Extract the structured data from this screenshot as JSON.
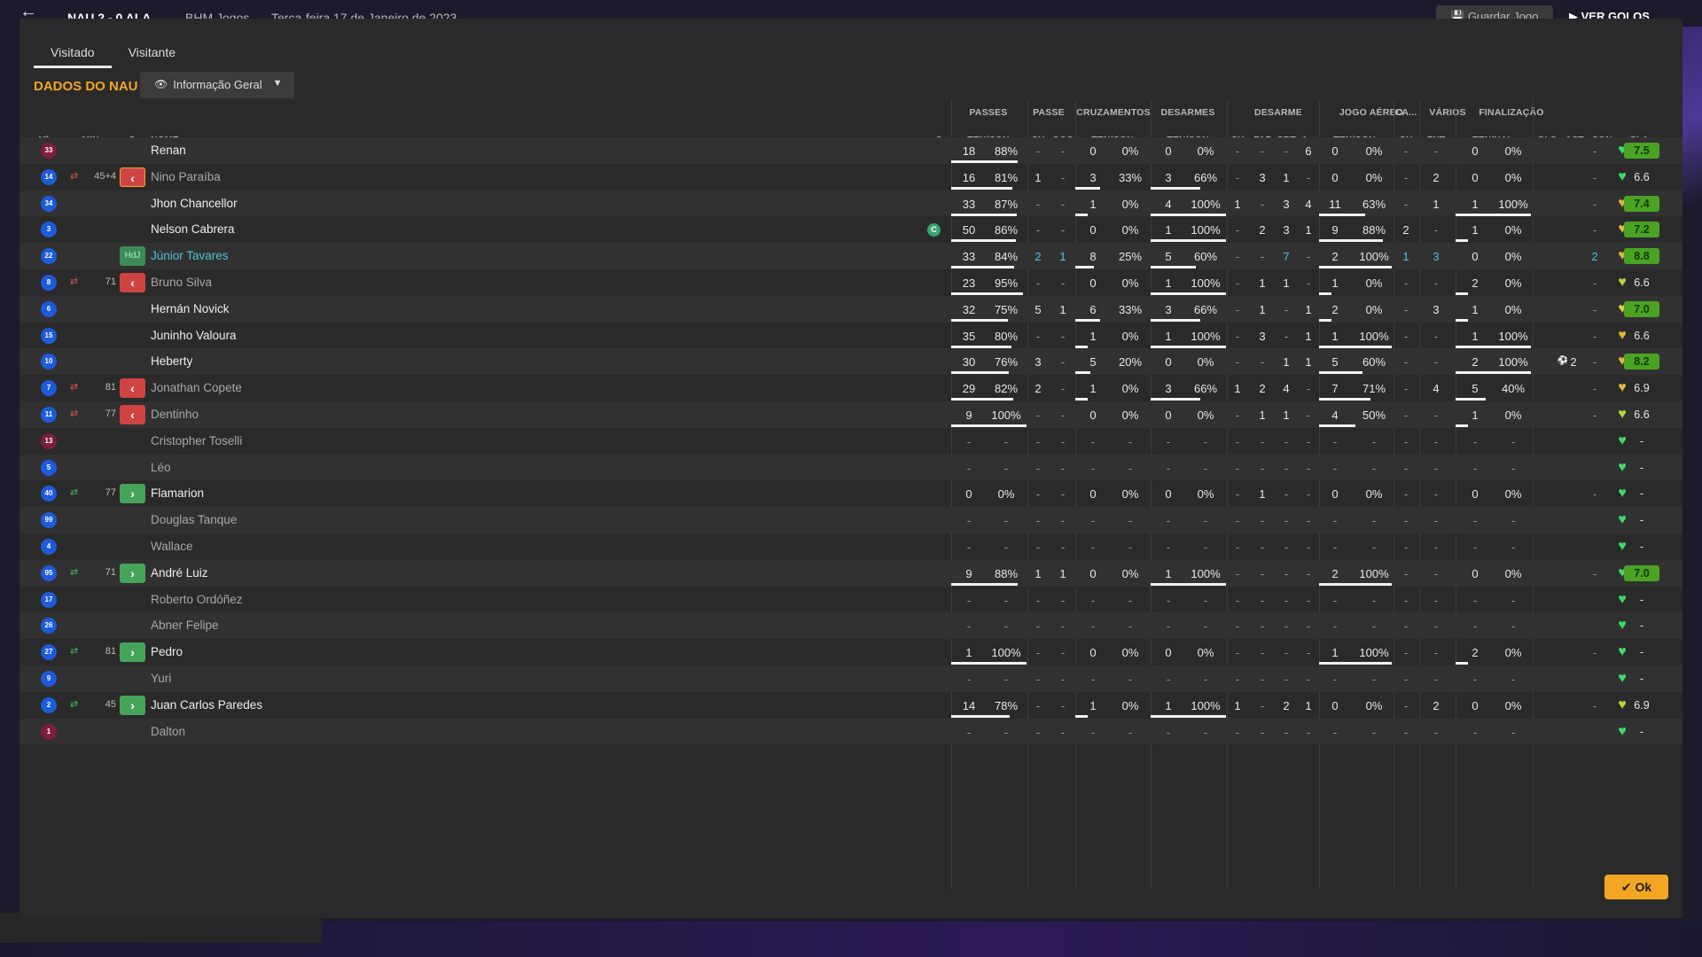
{
  "topbar": {
    "score": "NAU  2 - 0  ALA",
    "league": "BHM Jogos",
    "date": "Terça-feira 17 de Janeiro de 2023",
    "save_label": "Guardar Jogo",
    "goals_label": "VER GOLOS"
  },
  "tabs": [
    {
      "label": "Visitado",
      "active": true
    },
    {
      "label": "Visitante",
      "active": false
    }
  ],
  "section_title": "DADOS DO NAU",
  "view_select": {
    "value": "Informação Geral"
  },
  "group_headers": {
    "passes": "PASSES",
    "passe": "PASSE",
    "cruzamentos": "CRUZAMENTOS",
    "desarmes": "DESARMES",
    "desarme": "DESARME",
    "jogo_aereo": "JOGO AÉREO",
    "ca": "CA...",
    "varios": "VÁRIOS",
    "finalizacao": "FINALIZAÇÃO"
  },
  "column_headers": {
    "num": "Nº",
    "min": "MIN",
    "s": "S",
    "nome": "NOME",
    "c": "C",
    "passes": "TEN/CON",
    "passe_ch": "CH",
    "passe_ocg": "OCG",
    "cruz": "TEN/CON",
    "desarmes": "TEN/CON",
    "des_ch": "CH",
    "des_faf": "FAF",
    "des_crt": "CRT",
    "des_a": "A...",
    "aereo": "TEN/CON",
    "ca_ch": "CH",
    "var_fnt": "FNT",
    "fin": "TEN/NAL",
    "gls": "GLS",
    "ast": "AST",
    "con": "CON",
    "cla": "CLA"
  },
  "players": [
    {
      "num": "33",
      "gk": true,
      "min": "",
      "sub": "",
      "subst": "",
      "name": "Renan",
      "style": "",
      "c": "",
      "pass_t": "18",
      "pass_p": "88%",
      "pass_pct": 88,
      "p_ch": "-",
      "p_ocg": "-",
      "cr_t": "0",
      "cr_p": "0%",
      "cr_pct": 0,
      "ds_t": "0",
      "ds_p": "0%",
      "ds_pct": 0,
      "d_ch": "-",
      "d_faf": "-",
      "d_crt": "-",
      "d_a": "6",
      "ae_t": "0",
      "ae_p": "0%",
      "ae_pct": 0,
      "ca_ch": "-",
      "fnt": "-",
      "fi_t": "0",
      "fi_p": "0%",
      "fi_pct": 0,
      "gls": "",
      "ast": "-",
      "heart": "#3ddc6a",
      "cla": "7.5",
      "cla_good": true
    },
    {
      "num": "14",
      "gk": false,
      "min": "45+4",
      "sub": "out",
      "subst": "out-b",
      "name": "Nino Paraíba",
      "style": "dim",
      "c": "",
      "pass_t": "16",
      "pass_p": "81%",
      "pass_pct": 81,
      "p_ch": "1",
      "p_ocg": "-",
      "cr_t": "3",
      "cr_p": "33%",
      "cr_pct": 33,
      "ds_t": "3",
      "ds_p": "66%",
      "ds_pct": 66,
      "d_ch": "-",
      "d_faf": "3",
      "d_crt": "1",
      "d_a": "-",
      "ae_t": "0",
      "ae_p": "0%",
      "ae_pct": 0,
      "ca_ch": "-",
      "fnt": "2",
      "fi_t": "0",
      "fi_p": "0%",
      "fi_pct": 0,
      "gls": "",
      "ast": "-",
      "heart": "#3ddc6a",
      "cla": "6.6",
      "cla_good": false
    },
    {
      "num": "34",
      "gk": false,
      "min": "",
      "sub": "",
      "subst": "",
      "name": "Jhon Chancellor",
      "style": "",
      "c": "",
      "pass_t": "33",
      "pass_p": "87%",
      "pass_pct": 87,
      "p_ch": "-",
      "p_ocg": "-",
      "cr_t": "1",
      "cr_p": "0%",
      "cr_pct": 0,
      "ds_t": "4",
      "ds_p": "100%",
      "ds_pct": 100,
      "d_ch": "1",
      "d_faf": "-",
      "d_crt": "3",
      "d_a": "4",
      "ae_t": "11",
      "ae_p": "63%",
      "ae_pct": 63,
      "ca_ch": "-",
      "fnt": "1",
      "fi_t": "1",
      "fi_p": "100%",
      "fi_pct": 100,
      "gls": "",
      "ast": "-",
      "heart": "#e0b73a",
      "cla": "7.4",
      "cla_good": true
    },
    {
      "num": "3",
      "gk": false,
      "min": "",
      "sub": "",
      "subst": "",
      "name": "Nelson Cabrera",
      "style": "",
      "c": "C",
      "pass_t": "50",
      "pass_p": "86%",
      "pass_pct": 86,
      "p_ch": "-",
      "p_ocg": "-",
      "cr_t": "0",
      "cr_p": "0%",
      "cr_pct": 0,
      "ds_t": "1",
      "ds_p": "100%",
      "ds_pct": 100,
      "d_ch": "-",
      "d_faf": "2",
      "d_crt": "3",
      "d_a": "1",
      "ae_t": "9",
      "ae_p": "88%",
      "ae_pct": 88,
      "ca_ch": "2",
      "fnt": "-",
      "fi_t": "1",
      "fi_p": "0%",
      "fi_pct": 0,
      "gls": "",
      "ast": "-",
      "heart": "#e0b73a",
      "cla": "7.2",
      "cla_good": true
    },
    {
      "num": "22",
      "gk": false,
      "min": "",
      "sub": "",
      "subst": "hdj",
      "name": "Júnior Tavares",
      "style": "hl",
      "c": "",
      "pass_t": "33",
      "pass_p": "84%",
      "pass_pct": 84,
      "p_ch": "2",
      "p_ocg": "1",
      "cr_t": "8",
      "cr_p": "25%",
      "cr_pct": 25,
      "ds_t": "5",
      "ds_p": "60%",
      "ds_pct": 60,
      "d_ch": "-",
      "d_faf": "-",
      "d_crt": "7",
      "d_a": "-",
      "ae_t": "2",
      "ae_p": "100%",
      "ae_pct": 100,
      "ca_ch": "1",
      "fnt": "3",
      "fi_t": "0",
      "fi_p": "0%",
      "fi_pct": 0,
      "gls": "",
      "ast": "2",
      "heart": "#e0b73a",
      "cla": "8.8",
      "cla_good": true,
      "stat_hl": true
    },
    {
      "num": "8",
      "gk": false,
      "min": "71",
      "sub": "out",
      "subst": "out",
      "name": "Bruno Silva",
      "style": "dim",
      "c": "",
      "pass_t": "23",
      "pass_p": "95%",
      "pass_pct": 95,
      "p_ch": "-",
      "p_ocg": "-",
      "cr_t": "0",
      "cr_p": "0%",
      "cr_pct": 0,
      "ds_t": "1",
      "ds_p": "100%",
      "ds_pct": 100,
      "d_ch": "-",
      "d_faf": "1",
      "d_crt": "1",
      "d_a": "-",
      "ae_t": "1",
      "ae_p": "0%",
      "ae_pct": 0,
      "ca_ch": "-",
      "fnt": "-",
      "fi_t": "2",
      "fi_p": "0%",
      "fi_pct": 0,
      "gls": "",
      "ast": "-",
      "heart": "#b8d83a",
      "cla": "6.6",
      "cla_good": false
    },
    {
      "num": "6",
      "gk": false,
      "min": "",
      "sub": "",
      "subst": "",
      "name": "Hernán Novick",
      "style": "",
      "c": "",
      "pass_t": "32",
      "pass_p": "75%",
      "pass_pct": 75,
      "p_ch": "5",
      "p_ocg": "1",
      "cr_t": "6",
      "cr_p": "33%",
      "cr_pct": 33,
      "ds_t": "3",
      "ds_p": "66%",
      "ds_pct": 66,
      "d_ch": "-",
      "d_faf": "1",
      "d_crt": "-",
      "d_a": "1",
      "ae_t": "2",
      "ae_p": "0%",
      "ae_pct": 0,
      "ca_ch": "-",
      "fnt": "3",
      "fi_t": "1",
      "fi_p": "0%",
      "fi_pct": 0,
      "gls": "",
      "ast": "-",
      "heart": "#e0d03a",
      "cla": "7.0",
      "cla_good": true
    },
    {
      "num": "15",
      "gk": false,
      "min": "",
      "sub": "",
      "subst": "",
      "name": "Juninho Valoura",
      "style": "",
      "c": "",
      "pass_t": "35",
      "pass_p": "80%",
      "pass_pct": 80,
      "p_ch": "-",
      "p_ocg": "-",
      "cr_t": "1",
      "cr_p": "0%",
      "cr_pct": 0,
      "ds_t": "1",
      "ds_p": "100%",
      "ds_pct": 100,
      "d_ch": "-",
      "d_faf": "3",
      "d_crt": "-",
      "d_a": "1",
      "ae_t": "1",
      "ae_p": "100%",
      "ae_pct": 100,
      "ca_ch": "-",
      "fnt": "-",
      "fi_t": "1",
      "fi_p": "100%",
      "fi_pct": 100,
      "gls": "",
      "ast": "-",
      "heart": "#e0b73a",
      "cla": "6.6",
      "cla_good": false
    },
    {
      "num": "10",
      "gk": false,
      "min": "",
      "sub": "",
      "subst": "",
      "name": "Heberty",
      "style": "",
      "c": "",
      "pass_t": "30",
      "pass_p": "76%",
      "pass_pct": 76,
      "p_ch": "3",
      "p_ocg": "-",
      "cr_t": "5",
      "cr_p": "20%",
      "cr_pct": 20,
      "ds_t": "0",
      "ds_p": "0%",
      "ds_pct": 0,
      "d_ch": "-",
      "d_faf": "-",
      "d_crt": "1",
      "d_a": "1",
      "ae_t": "5",
      "ae_p": "60%",
      "ae_pct": 60,
      "ca_ch": "-",
      "fnt": "-",
      "fi_t": "2",
      "fi_p": "100%",
      "fi_pct": 100,
      "gls": "2",
      "ast": "-",
      "heart": "#e0b73a",
      "cla": "8.2",
      "cla_good": true
    },
    {
      "num": "7",
      "gk": false,
      "min": "81",
      "sub": "out",
      "subst": "out",
      "name": "Jonathan Copete",
      "style": "dim",
      "c": "",
      "pass_t": "29",
      "pass_p": "82%",
      "pass_pct": 82,
      "p_ch": "2",
      "p_ocg": "-",
      "cr_t": "1",
      "cr_p": "0%",
      "cr_pct": 0,
      "ds_t": "3",
      "ds_p": "66%",
      "ds_pct": 66,
      "d_ch": "1",
      "d_faf": "2",
      "d_crt": "4",
      "d_a": "-",
      "ae_t": "7",
      "ae_p": "71%",
      "ae_pct": 71,
      "ca_ch": "-",
      "fnt": "4",
      "fi_t": "5",
      "fi_p": "40%",
      "fi_pct": 40,
      "gls": "",
      "ast": "-",
      "heart": "#e0b73a",
      "cla": "6.9",
      "cla_good": false
    },
    {
      "num": "11",
      "gk": false,
      "min": "77",
      "sub": "out",
      "subst": "out",
      "name": "Dentinho",
      "style": "dim",
      "c": "",
      "pass_t": "9",
      "pass_p": "100%",
      "pass_pct": 100,
      "p_ch": "-",
      "p_ocg": "-",
      "cr_t": "0",
      "cr_p": "0%",
      "cr_pct": 0,
      "ds_t": "0",
      "ds_p": "0%",
      "ds_pct": 0,
      "d_ch": "-",
      "d_faf": "1",
      "d_crt": "1",
      "d_a": "-",
      "ae_t": "4",
      "ae_p": "50%",
      "ae_pct": 50,
      "ca_ch": "-",
      "fnt": "-",
      "fi_t": "1",
      "fi_p": "0%",
      "fi_pct": 0,
      "gls": "",
      "ast": "-",
      "heart": "#b8d83a",
      "cla": "6.6",
      "cla_good": false
    },
    {
      "num": "13",
      "gk": true,
      "min": "",
      "sub": "",
      "subst": "",
      "name": "Cristopher Toselli",
      "style": "dim",
      "c": "",
      "empty": true,
      "ast": "",
      "heart": "#3ddc6a",
      "cla": "-",
      "cla_good": false
    },
    {
      "num": "5",
      "gk": false,
      "min": "",
      "sub": "",
      "subst": "",
      "name": "Léo",
      "style": "dim",
      "c": "",
      "empty": true,
      "ast": "",
      "heart": "#3ddc6a",
      "cla": "-",
      "cla_good": false
    },
    {
      "num": "40",
      "gk": false,
      "min": "77",
      "sub": "in",
      "subst": "in",
      "name": "Flamarion",
      "style": "",
      "c": "",
      "pass_t": "0",
      "pass_p": "0%",
      "pass_pct": 0,
      "p_ch": "-",
      "p_ocg": "-",
      "cr_t": "0",
      "cr_p": "0%",
      "cr_pct": 0,
      "ds_t": "0",
      "ds_p": "0%",
      "ds_pct": 0,
      "d_ch": "-",
      "d_faf": "1",
      "d_crt": "-",
      "d_a": "-",
      "ae_t": "0",
      "ae_p": "0%",
      "ae_pct": 0,
      "ca_ch": "-",
      "fnt": "-",
      "fi_t": "0",
      "fi_p": "0%",
      "fi_pct": 0,
      "gls": "",
      "ast": "-",
      "heart": "#3ddc6a",
      "cla": "-",
      "cla_good": false
    },
    {
      "num": "99",
      "gk": false,
      "min": "",
      "sub": "",
      "subst": "",
      "name": "Douglas Tanque",
      "style": "dim",
      "c": "",
      "empty": true,
      "ast": "",
      "heart": "#3ddc6a",
      "cla": "-",
      "cla_good": false
    },
    {
      "num": "4",
      "gk": false,
      "min": "",
      "sub": "",
      "subst": "",
      "name": "Wallace",
      "style": "dim",
      "c": "",
      "empty": true,
      "ast": "",
      "heart": "#3ddc6a",
      "cla": "-",
      "cla_good": false
    },
    {
      "num": "95",
      "gk": false,
      "min": "71",
      "sub": "in",
      "subst": "in",
      "name": "André Luiz",
      "style": "",
      "c": "",
      "pass_t": "9",
      "pass_p": "88%",
      "pass_pct": 88,
      "p_ch": "1",
      "p_ocg": "1",
      "cr_t": "0",
      "cr_p": "0%",
      "cr_pct": 0,
      "ds_t": "1",
      "ds_p": "100%",
      "ds_pct": 100,
      "d_ch": "-",
      "d_faf": "-",
      "d_crt": "-",
      "d_a": "-",
      "ae_t": "2",
      "ae_p": "100%",
      "ae_pct": 100,
      "ca_ch": "-",
      "fnt": "-",
      "fi_t": "0",
      "fi_p": "0%",
      "fi_pct": 0,
      "gls": "",
      "ast": "-",
      "heart": "#3ddc6a",
      "cla": "7.0",
      "cla_good": true
    },
    {
      "num": "17",
      "gk": false,
      "min": "",
      "sub": "",
      "subst": "",
      "name": "Roberto Ordóñez",
      "style": "dim",
      "c": "",
      "empty": true,
      "ast": "",
      "heart": "#3ddc6a",
      "cla": "-",
      "cla_good": false
    },
    {
      "num": "26",
      "gk": false,
      "min": "",
      "sub": "",
      "subst": "",
      "name": "Abner Felipe",
      "style": "dim",
      "c": "",
      "empty": true,
      "ast": "",
      "heart": "#3ddc6a",
      "cla": "-",
      "cla_good": false
    },
    {
      "num": "27",
      "gk": false,
      "min": "81",
      "sub": "in",
      "subst": "in",
      "name": "Pedro",
      "style": "",
      "c": "",
      "pass_t": "1",
      "pass_p": "100%",
      "pass_pct": 100,
      "p_ch": "-",
      "p_ocg": "-",
      "cr_t": "0",
      "cr_p": "0%",
      "cr_pct": 0,
      "ds_t": "0",
      "ds_p": "0%",
      "ds_pct": 0,
      "d_ch": "-",
      "d_faf": "-",
      "d_crt": "-",
      "d_a": "-",
      "ae_t": "1",
      "ae_p": "100%",
      "ae_pct": 100,
      "ca_ch": "-",
      "fnt": "-",
      "fi_t": "2",
      "fi_p": "0%",
      "fi_pct": 0,
      "gls": "",
      "ast": "-",
      "heart": "#3ddc6a",
      "cla": "-",
      "cla_good": false
    },
    {
      "num": "9",
      "gk": false,
      "min": "",
      "sub": "",
      "subst": "",
      "name": "Yuri",
      "style": "dim",
      "c": "",
      "empty": true,
      "ast": "",
      "heart": "#3ddc6a",
      "cla": "-",
      "cla_good": false
    },
    {
      "num": "2",
      "gk": false,
      "min": "45",
      "sub": "in",
      "subst": "in",
      "name": "Juan Carlos Paredes",
      "style": "",
      "c": "",
      "pass_t": "14",
      "pass_p": "78%",
      "pass_pct": 78,
      "p_ch": "-",
      "p_ocg": "-",
      "cr_t": "1",
      "cr_p": "0%",
      "cr_pct": 0,
      "ds_t": "1",
      "ds_p": "100%",
      "ds_pct": 100,
      "d_ch": "1",
      "d_faf": "-",
      "d_crt": "2",
      "d_a": "1",
      "ae_t": "0",
      "ae_p": "0%",
      "ae_pct": 0,
      "ca_ch": "-",
      "fnt": "2",
      "fi_t": "0",
      "fi_p": "0%",
      "fi_pct": 0,
      "gls": "",
      "ast": "-",
      "heart": "#b8d83a",
      "cla": "6.9",
      "cla_good": false
    },
    {
      "num": "1",
      "gk": true,
      "min": "",
      "sub": "",
      "subst": "",
      "name": "Dalton",
      "style": "dim",
      "c": "",
      "empty": true,
      "ast": "",
      "heart": "#3ddc6a",
      "cla": "-",
      "cla_good": false
    }
  ],
  "ok_label": "Ok"
}
